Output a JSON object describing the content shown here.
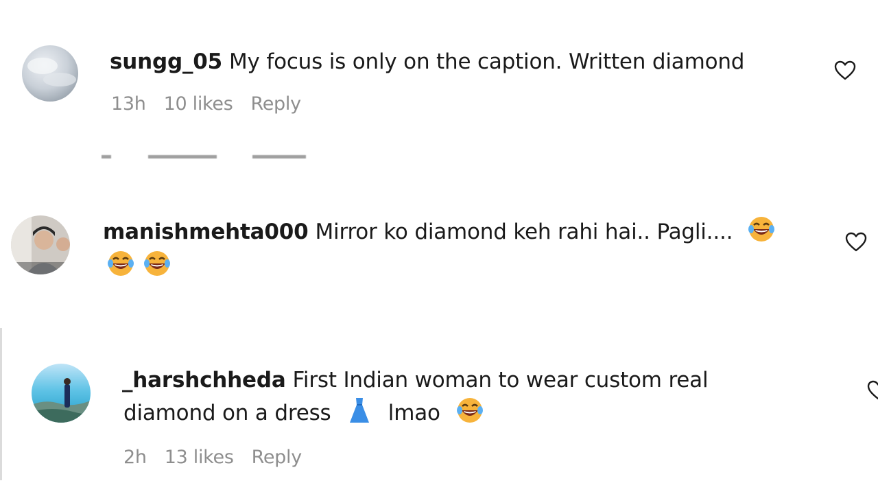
{
  "comments": [
    {
      "username": "sungg_05",
      "text": "My focus is only on the caption. Written diamond",
      "time": "13h",
      "likes": "10 likes",
      "reply": "Reply",
      "avatar_icon": "cloudy-sky-avatar"
    },
    {
      "username": "manishmehta000",
      "text": "Mirror ko diamond keh rahi hai.. Pagli....",
      "emoji_icon": "face-with-tears-of-joy-icon",
      "avatar_icon": "person-photo-avatar"
    },
    {
      "username": "_harshchheda",
      "text_line1": "First Indian woman to wear custom real",
      "text_line2": "diamond on a dress",
      "text_line2_suffix": "lmao",
      "dress_icon": "blue-dress-icon",
      "emoji_icon": "face-with-tears-of-joy-icon",
      "time": "2h",
      "likes": "13 likes",
      "reply": "Reply",
      "avatar_icon": "beach-photo-avatar"
    }
  ],
  "colors": {
    "text": "#1a1a1a",
    "muted": "#8e8e8e",
    "emoji_face": "#f7b33b",
    "dress": "#3a8ee6"
  }
}
